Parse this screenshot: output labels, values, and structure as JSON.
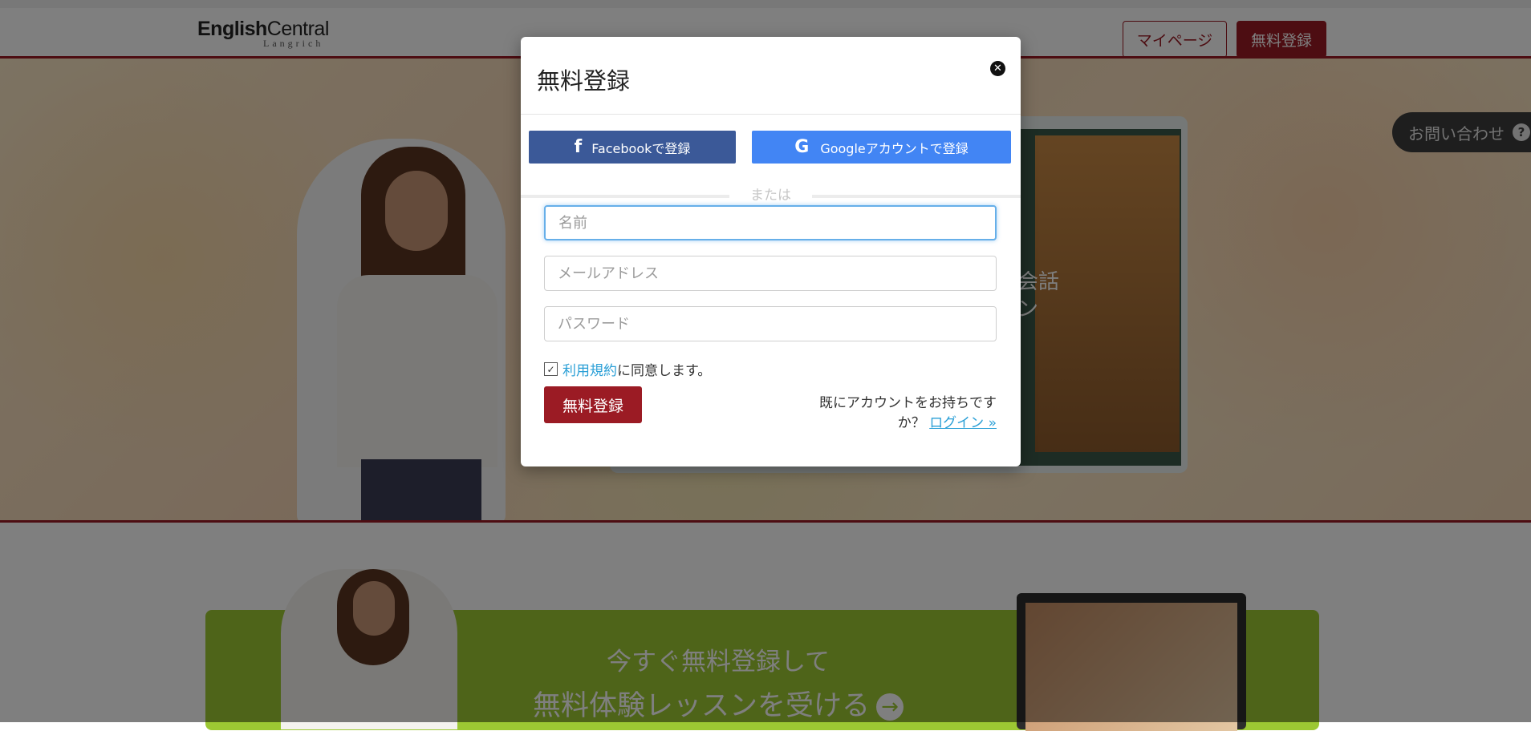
{
  "header": {
    "logo_text_bold": "English",
    "logo_text_regular": "Central",
    "logo_subtext": "Langrich",
    "mypage_label": "マイページ",
    "register_label": "無料登録"
  },
  "hero": {
    "text_line1": "会話",
    "text_line2": "ン"
  },
  "contact_tab": {
    "label": "お問い合わせ",
    "icon": "question-icon"
  },
  "cta": {
    "line1": "今すぐ無料登録して",
    "line2": "無料体験レッスンを受ける",
    "icon": "arrow-right-circle-icon"
  },
  "modal": {
    "title": "無料登録",
    "close_icon": "close-icon",
    "facebook_label": "Facebookで登録",
    "google_label": "Googleアカウントで登録",
    "divider_label": "または",
    "name_placeholder": "名前",
    "email_placeholder": "メールアドレス",
    "password_placeholder": "パスワード",
    "terms_link": "利用規約",
    "terms_suffix": "に同意します。",
    "terms_checked": true,
    "submit_label": "無料登録",
    "login_prompt_line1": "既にアカウントをお持ちです",
    "login_prompt_line2": "か？",
    "login_link": "ログイン »"
  },
  "colors": {
    "brand_red": "#9b1b24",
    "facebook_blue": "#3b5998",
    "google_blue": "#4285f4",
    "link_blue": "#2a9fd6",
    "cta_green": "#9cc833"
  }
}
